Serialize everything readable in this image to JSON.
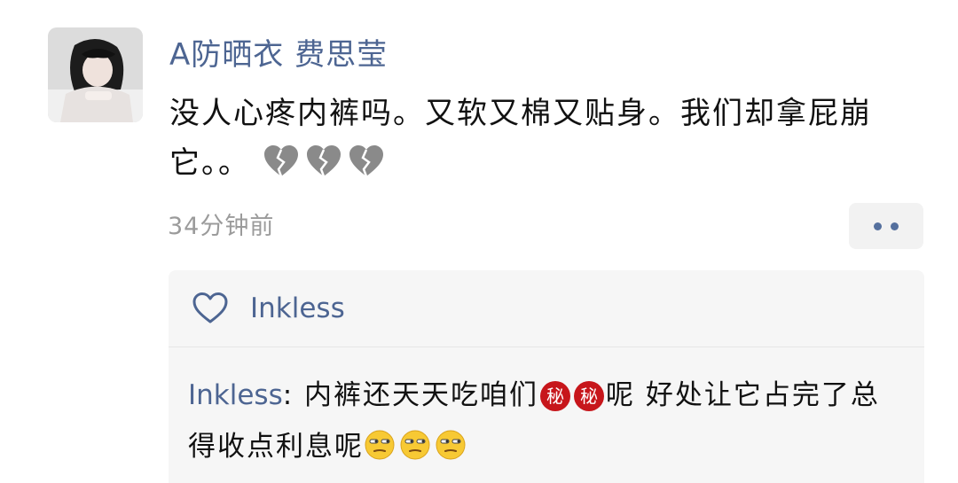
{
  "post": {
    "username": "A防晒衣 费思莹",
    "text": "没人心疼内裤吗。又软又棉又贴身。我们却拿屁崩它。。",
    "timestamp": "34分钟前"
  },
  "icons": {
    "post_emoji": "broken-heart-icon",
    "comment_secret": "secret-icon",
    "comment_emoji": "unamused-face-icon",
    "more": "more-dots-icon",
    "like": "heart-outline-icon"
  },
  "likes": {
    "names": "Inkless"
  },
  "comments": [
    {
      "author": "Inkless",
      "separator": ": ",
      "text_part1": "内裤还天天吃咱们",
      "secret_glyph": "秘",
      "text_part2": "呢 好处让它占完了总得收点利息呢"
    }
  ],
  "colors": {
    "link": "#4d6592",
    "panel_bg": "#f6f6f6",
    "secret_badge": "#c7161b",
    "timestamp": "#9b9b9b"
  }
}
